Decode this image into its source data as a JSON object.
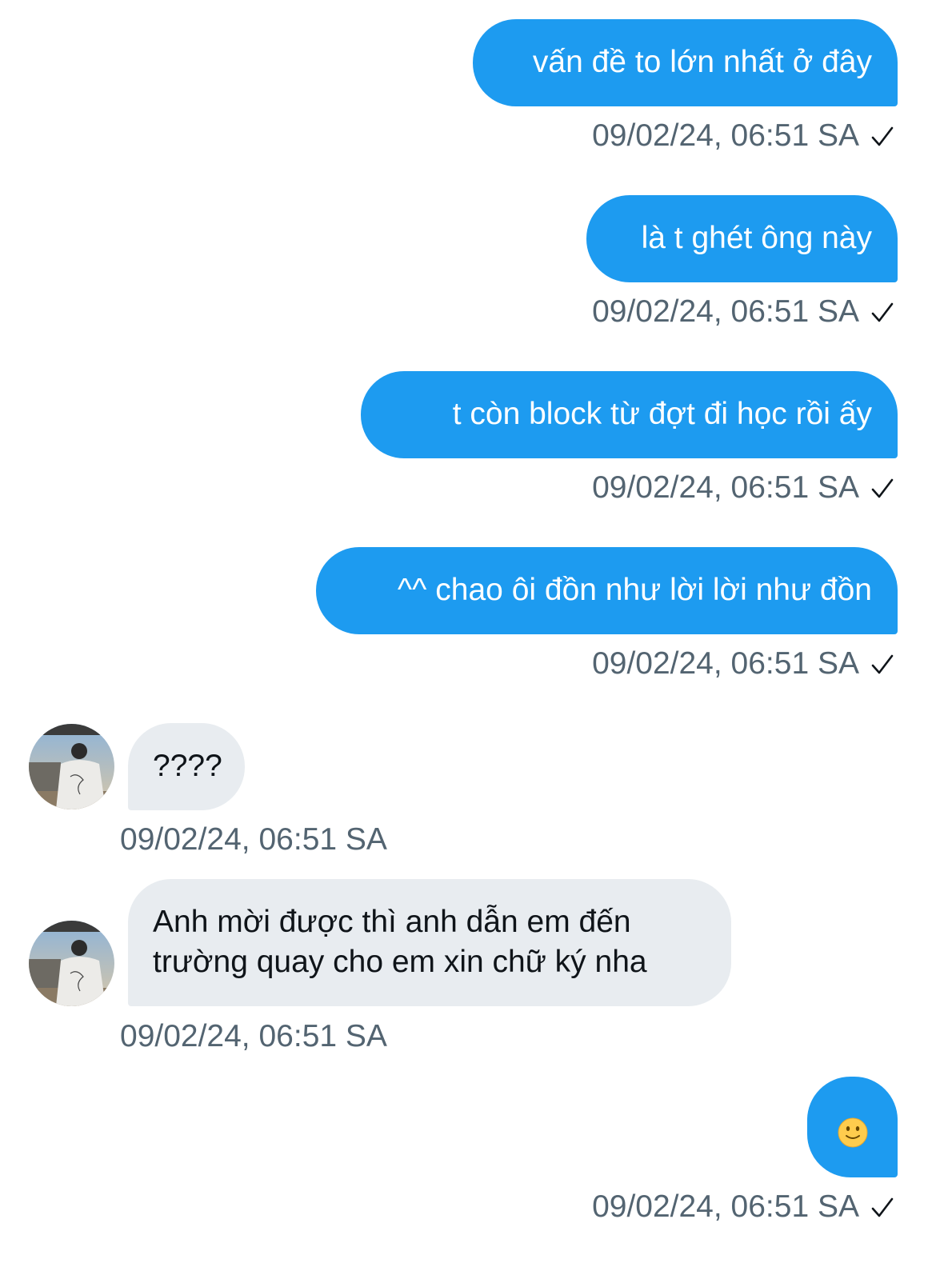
{
  "conversation": {
    "messages": [
      {
        "direction": "sent",
        "text": "vấn đề to lớn nhất ở đây",
        "timestamp": "09/02/24, 06:51 SA",
        "status": "sent-check-icon"
      },
      {
        "direction": "sent",
        "text": "là t ghét ông này",
        "timestamp": "09/02/24, 06:51 SA",
        "status": "sent-check-icon"
      },
      {
        "direction": "sent",
        "text": "t còn block từ đợt đi học rồi ấy",
        "timestamp": "09/02/24, 06:51 SA",
        "status": "sent-check-icon"
      },
      {
        "direction": "sent",
        "text": "^^ chao ôi đồn như lời lời như đồn",
        "timestamp": "09/02/24, 06:51 SA",
        "status": "sent-check-icon"
      },
      {
        "direction": "received",
        "text": "????",
        "timestamp": "09/02/24, 06:51 SA"
      },
      {
        "direction": "received",
        "text_lines": [
          "Anh mời được thì anh dẫn em đến",
          "trường quay cho em xin chữ ký nha"
        ],
        "timestamp": "09/02/24, 06:51 SA"
      },
      {
        "direction": "sent",
        "emoji": "slightly-smiling-face-icon",
        "timestamp": "09/02/24, 06:51 SA",
        "status": "sent-check-icon"
      }
    ]
  },
  "colors": {
    "sent_bubble": "#1d9bf0",
    "received_bubble": "#e8ecf0",
    "timestamp_text": "#536471",
    "received_text": "#0f1419"
  }
}
